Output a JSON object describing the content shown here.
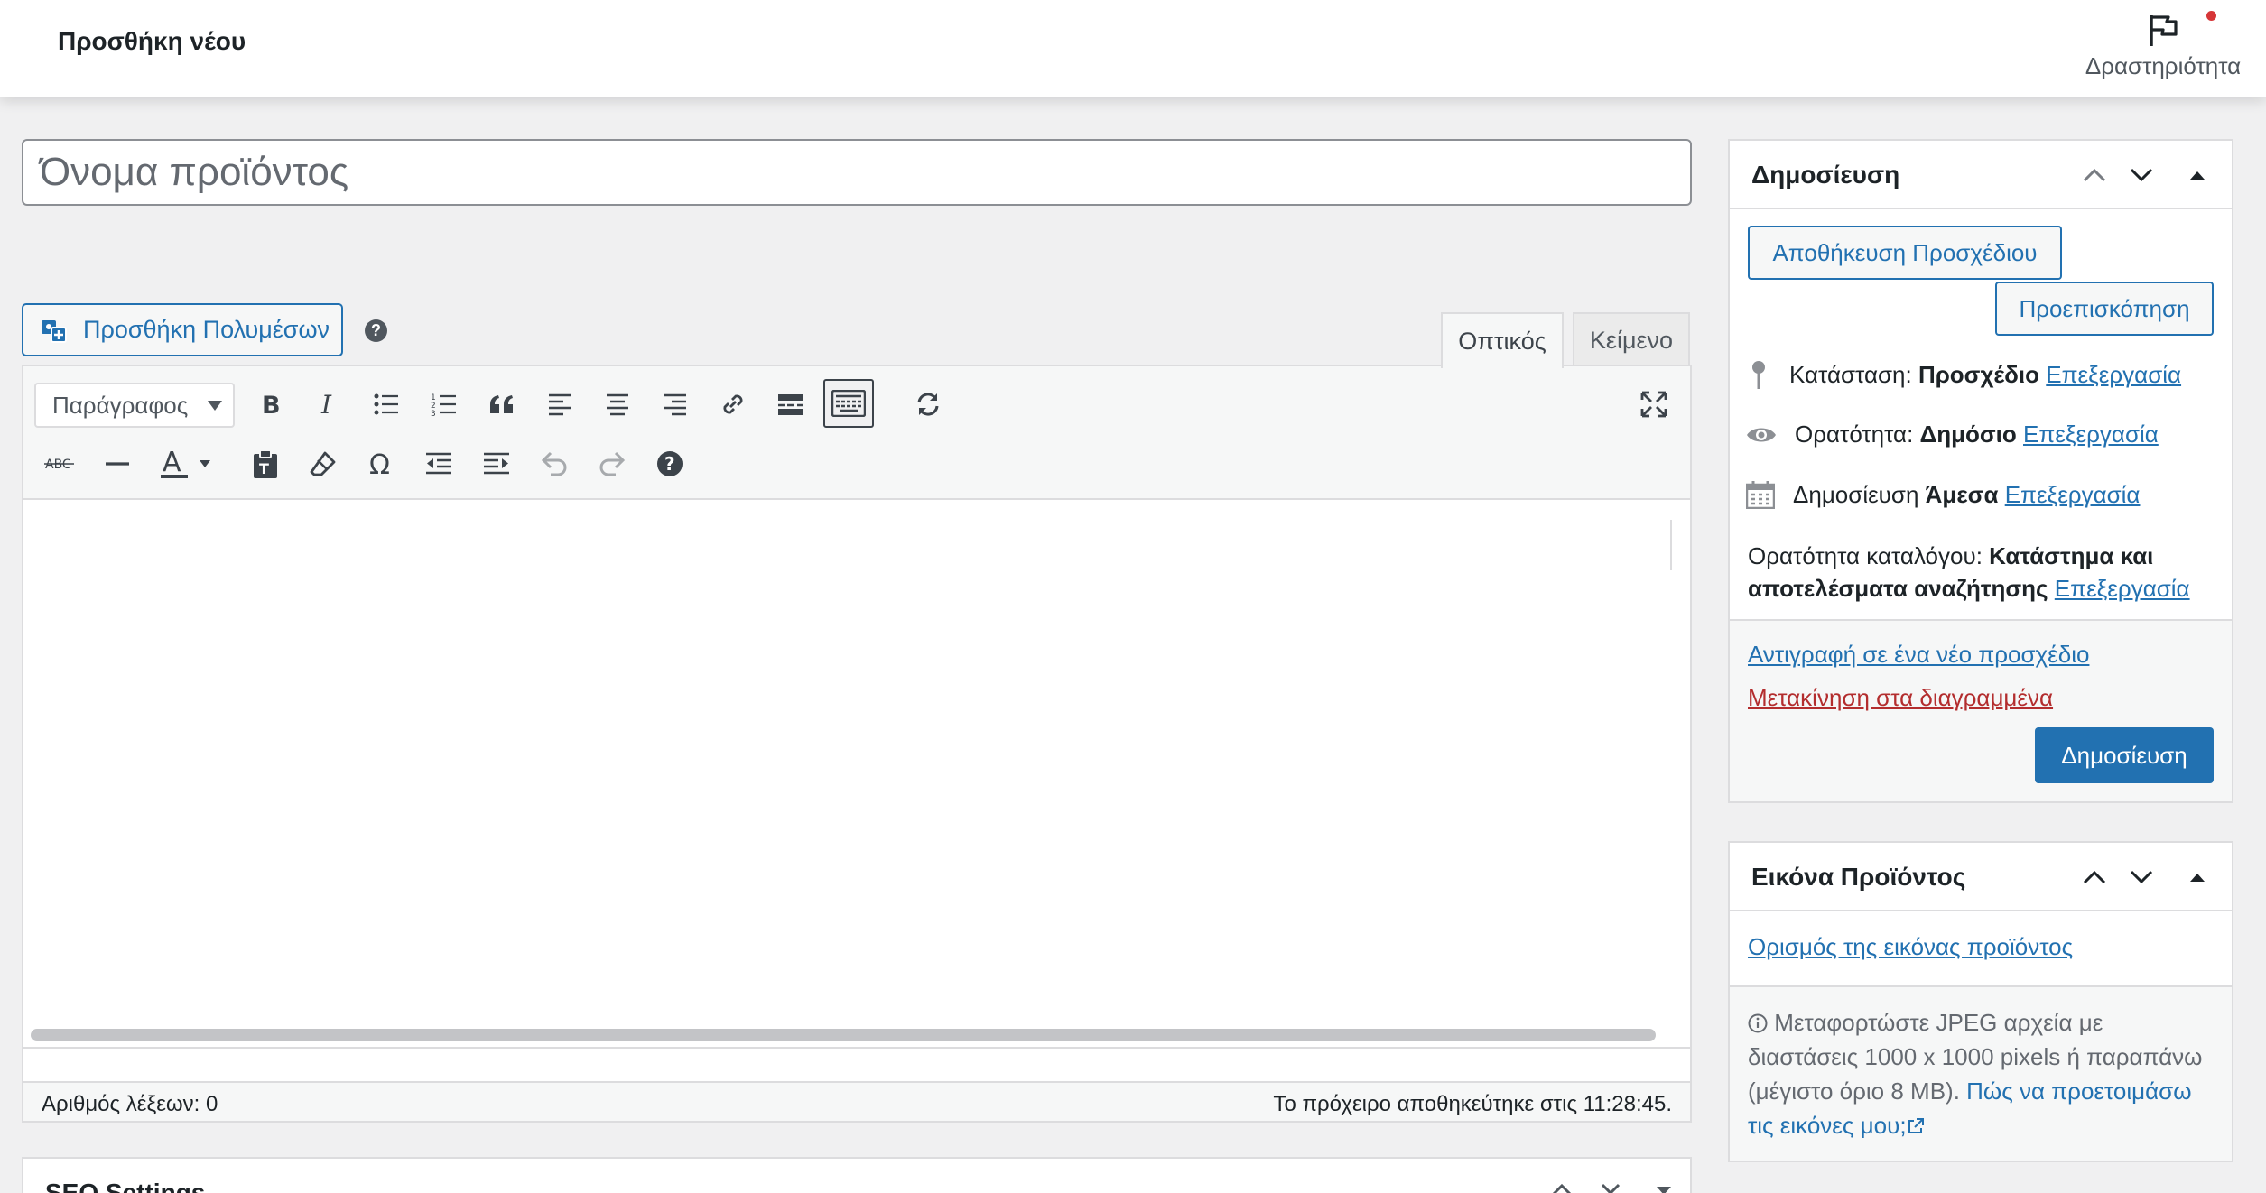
{
  "topbar": {
    "title": "Προσθήκη νέου",
    "activity_label": "Δραστηριότητα"
  },
  "title_field": {
    "placeholder": "Όνομα προϊόντος"
  },
  "editor": {
    "add_media_label": "Προσθήκη Πολυμέσων",
    "help_label": "?",
    "tabs": [
      {
        "label": "Οπτικός",
        "active": true
      },
      {
        "label": "Κείμενο",
        "active": false
      }
    ],
    "format_select": "Παράγραφος",
    "word_count": "Αριθμός λέξεων: 0",
    "autosave": "Το πρόχειρο αποθηκεύτηκε στις 11:28:45.",
    "toolbar_row1_icons": [
      "bold-icon",
      "italic-icon",
      "bullet-list-icon",
      "numbered-list-icon",
      "blockquote-icon",
      "align-left-icon",
      "align-center-icon",
      "align-right-icon",
      "link-icon",
      "read-more-icon",
      "toolbar-toggle-icon",
      "refresh-icon",
      "fullscreen-icon"
    ],
    "toolbar_row2_icons": [
      "strikethrough-icon",
      "horizontal-line-icon",
      "text-color-icon",
      "paste-text-icon",
      "clear-formatting-icon",
      "special-character-icon",
      "outdent-icon",
      "indent-icon",
      "undo-icon",
      "redo-icon",
      "help-icon"
    ],
    "strikethrough_glyph": "ABC",
    "text_color_glyph": "A",
    "special_char_glyph": "Ω"
  },
  "seo": {
    "title": "SEO Settings"
  },
  "publish_box": {
    "title": "Δημοσίευση",
    "save_draft_label": "Αποθήκευση Προσχέδιου",
    "preview_label": "Προεπισκόπηση",
    "status_label": "Κατάσταση:",
    "status_value": "Προσχέδιο",
    "visibility_label": "Ορατότητα:",
    "visibility_value": "Δημόσιο",
    "publish_label": "Δημοσίευση",
    "publish_value": "Άμεσα",
    "edit_link": "Επεξεργασία",
    "catalog_label": "Ορατότητα καταλόγου:",
    "catalog_value": "Κατάστημα και αποτελέσματα αναζήτησης",
    "duplicate_link": "Αντιγραφή σε ένα νέο προσχέδιο",
    "trash_link": "Μετακίνηση στα διαγραμμένα",
    "publish_button": "Δημοσίευση"
  },
  "product_image_box": {
    "title": "Εικόνα Προϊόντος",
    "set_image_link": "Ορισμός της εικόνας προϊόντος",
    "note_text": "Μεταφορτώστε JPEG αρχεία με διαστάσεις 1000 x 1000 pixels ή παραπάνω (μέγιστο όριο 8 MB).",
    "note_link": "Πώς να προετοιμάσω τις εικόνες μου;"
  },
  "colors": {
    "accent": "#2271b1",
    "danger": "#b32d2e",
    "notification_dot": "#d63638",
    "background": "#f0f0f1"
  }
}
